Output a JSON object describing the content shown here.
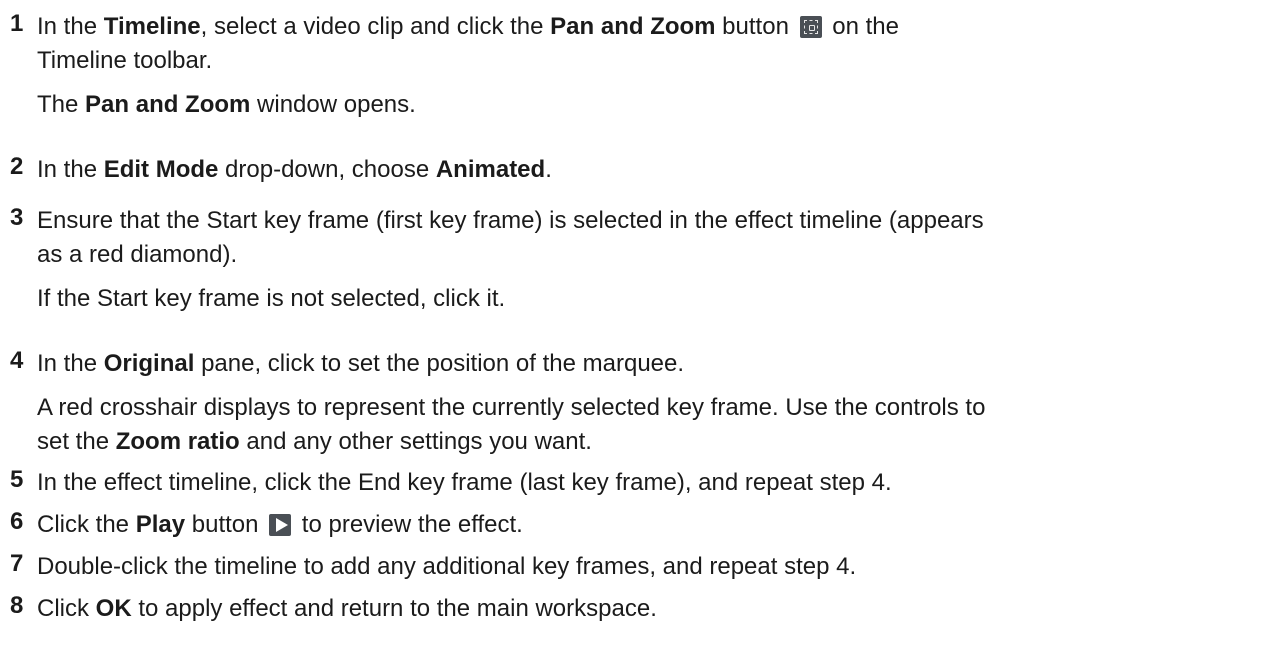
{
  "steps": [
    {
      "num": "1",
      "l1a": "In the ",
      "l1b": "Timeline",
      "l1c": ", select a video clip and click the ",
      "l1d": "Pan and Zoom",
      "l1e": " button ",
      "l1f": " on the",
      "l2": "Timeline toolbar.",
      "n_b": "Pan and Zoom",
      "n_pre": "The ",
      "n_post": " window opens."
    },
    {
      "num": "2",
      "a": "In the ",
      "b": "Edit Mode",
      "c": " drop-down, choose ",
      "d": "Animated",
      "e": "."
    },
    {
      "num": "3",
      "l1": "Ensure that the Start key frame (first key frame) is selected in the effect timeline (appears",
      "l2": "as a red diamond).",
      "note": "If the Start key frame is not selected, click it."
    },
    {
      "num": "4",
      "a": "In the ",
      "b": "Original",
      "c": " pane, click to set the position of the marquee.",
      "n1": "A red crosshair displays to represent the currently selected key frame. Use the controls to",
      "n2a": "set the ",
      "n2b": "Zoom ratio",
      "n2c": " and any other settings you want."
    },
    {
      "num": "5",
      "text": "In the effect timeline, click the End key frame (last key frame), and repeat step 4."
    },
    {
      "num": "6",
      "a": "Click the ",
      "b": "Play",
      "c": " button ",
      "d": " to preview the effect."
    },
    {
      "num": "7",
      "text": "Double-click the timeline to add any additional key frames, and repeat step 4."
    },
    {
      "num": "8",
      "a": "Click ",
      "b": "OK",
      "c": " to apply effect and return to the main workspace."
    }
  ],
  "icons": {
    "pan_zoom": "pan-and-zoom-icon",
    "play": "play-icon"
  }
}
